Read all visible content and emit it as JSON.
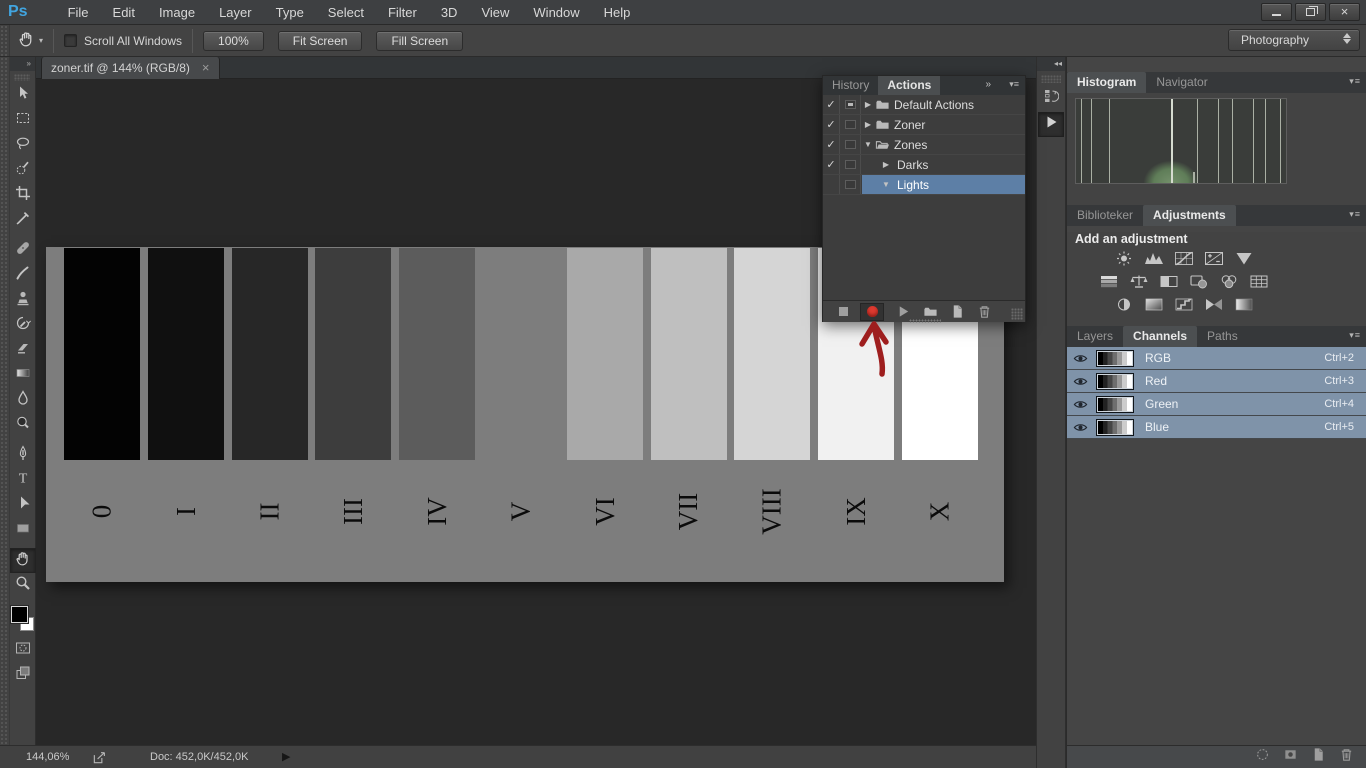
{
  "menu_bar": {
    "logo": "Ps",
    "items": [
      "File",
      "Edit",
      "Image",
      "Layer",
      "Type",
      "Select",
      "Filter",
      "3D",
      "View",
      "Window",
      "Help"
    ],
    "window_controls": [
      "minimize",
      "restore",
      "close"
    ]
  },
  "options_bar": {
    "tool_icon": "hand",
    "scroll_all_windows_label": "Scroll All Windows",
    "scroll_all_windows_checked": false,
    "buttons": [
      "100%",
      "Fit Screen",
      "Fill Screen"
    ],
    "workspace_selector": "Photography"
  },
  "document": {
    "tab_title": "zoner.tif @ 144% (RGB/8)",
    "close_glyph": "×",
    "status_zoom": "144,06%",
    "status_doc": "Doc: 452,0K/452,0K"
  },
  "toolbar": {
    "tools": [
      {
        "name": "move"
      },
      {
        "name": "rectangular-marquee"
      },
      {
        "name": "lasso"
      },
      {
        "name": "quick-selection"
      },
      {
        "name": "crop"
      },
      {
        "name": "eyedropper"
      },
      {
        "name": "spot-healing"
      },
      {
        "name": "brush"
      },
      {
        "name": "clone-stamp"
      },
      {
        "name": "history-brush"
      },
      {
        "name": "eraser"
      },
      {
        "name": "gradient"
      },
      {
        "name": "blur"
      },
      {
        "name": "dodge"
      },
      {
        "name": "pen"
      },
      {
        "name": "type"
      },
      {
        "name": "path-selection"
      },
      {
        "name": "rectangle-shape"
      },
      {
        "name": "hand",
        "selected": true
      },
      {
        "name": "zoom"
      }
    ],
    "foreground_color": "#000000",
    "background_color": "#ffffff"
  },
  "canvas": {
    "background": "#7d7d7d",
    "zones": [
      {
        "label": "0",
        "color": "#030303"
      },
      {
        "label": "I",
        "color": "#101010"
      },
      {
        "label": "II",
        "color": "#272727"
      },
      {
        "label": "III",
        "color": "#3d3d3d"
      },
      {
        "label": "IV",
        "color": "#5c5c5c"
      },
      {
        "label": "V",
        "color": "#7d7d7d"
      },
      {
        "label": "VI",
        "color": "#a9a9a9"
      },
      {
        "label": "VII",
        "color": "#bfbfbf"
      },
      {
        "label": "VIII",
        "color": "#d5d5d5"
      },
      {
        "label": "IX",
        "color": "#f1f1f1"
      },
      {
        "label": "X",
        "color": "#ffffff"
      }
    ]
  },
  "actions_panel": {
    "tabs": [
      {
        "label": "History",
        "active": false
      },
      {
        "label": "Actions",
        "active": true
      }
    ],
    "rows": [
      {
        "label": "Default Actions",
        "checked": true,
        "modal": "partial",
        "arrow": "right",
        "icon": "folder",
        "indent": 0,
        "selected": false
      },
      {
        "label": "Zoner",
        "checked": true,
        "modal": "none",
        "arrow": "right",
        "icon": "folder",
        "indent": 0,
        "selected": false
      },
      {
        "label": "Zones",
        "checked": true,
        "modal": "none",
        "arrow": "down",
        "icon": "folder-open",
        "indent": 0,
        "selected": false
      },
      {
        "label": "Darks",
        "checked": true,
        "modal": "none",
        "arrow": "right",
        "icon": null,
        "indent": 1,
        "selected": false
      },
      {
        "label": "Lights",
        "checked": false,
        "modal": "none",
        "arrow": "down",
        "icon": null,
        "indent": 1,
        "selected": true
      }
    ],
    "footer_buttons": [
      "stop",
      "record",
      "play",
      "new-set",
      "new-action",
      "delete"
    ],
    "record_active": true,
    "selected_row_color": "#5d7fa6"
  },
  "annotation": {
    "shape": "hand-drawn-arrow",
    "color": "#9e1e1e",
    "points_to": "record-button"
  },
  "dock_strip": {
    "collapse_glyph": "◂◂",
    "icons": [
      "history-panel",
      "actions-panel"
    ],
    "active_icon": "actions-panel"
  },
  "right_dock": {
    "histogram": {
      "tabs": [
        {
          "label": "Histogram",
          "active": true
        },
        {
          "label": "Navigator",
          "active": false
        }
      ],
      "spikes": [
        0.023,
        0.07,
        0.155,
        0.45,
        0.575,
        0.675,
        0.745,
        0.845,
        0.9,
        0.97
      ],
      "main_spike": 0.45,
      "short_spike": 0.555,
      "spike_color": "#aab0a4",
      "main_spike_color": "#d6dcd0",
      "mound_color": "#6e8d68"
    },
    "adjustments": {
      "tabs": [
        {
          "label": "Biblioteker",
          "active": false
        },
        {
          "label": "Adjustments",
          "active": true
        }
      ],
      "heading": "Add an adjustment",
      "icon_rows": [
        [
          "brightness-contrast",
          "levels",
          "curves",
          "exposure",
          "vibrance"
        ],
        [
          "hue-saturation",
          "color-balance",
          "black-white",
          "photo-filter",
          "channel-mixer",
          "color-lookup"
        ],
        [
          "invert",
          "posterize",
          "threshold",
          "gradient-map",
          "selective-color"
        ]
      ]
    },
    "channels": {
      "tabs": [
        {
          "label": "Layers",
          "active": false
        },
        {
          "label": "Channels",
          "active": true
        },
        {
          "label": "Paths",
          "active": false
        }
      ],
      "rows": [
        {
          "name": "RGB",
          "shortcut": "Ctrl+2",
          "visible": true,
          "selected": true
        },
        {
          "name": "Red",
          "shortcut": "Ctrl+3",
          "visible": true,
          "selected": true
        },
        {
          "name": "Green",
          "shortcut": "Ctrl+4",
          "visible": true,
          "selected": true
        },
        {
          "name": "Blue",
          "shortcut": "Ctrl+5",
          "visible": true,
          "selected": true
        }
      ],
      "selected_row_color": "#7f93a9",
      "footer_icons": [
        "load-selection",
        "save-selection",
        "new-channel",
        "delete-channel"
      ]
    }
  }
}
